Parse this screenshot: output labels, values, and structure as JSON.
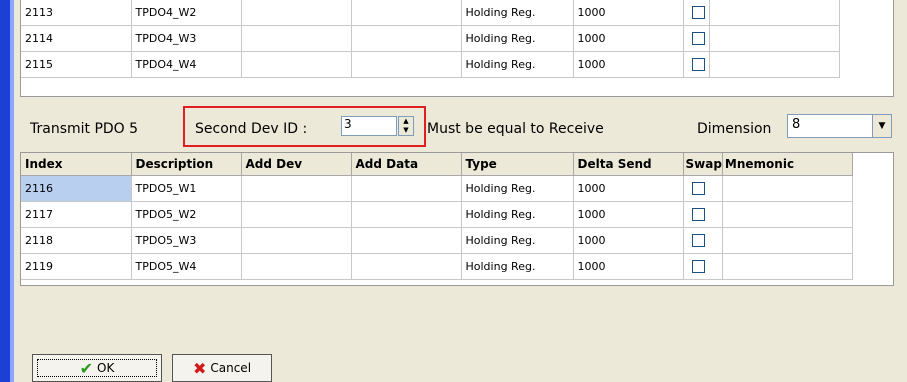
{
  "top_table": {
    "rows": [
      {
        "index": "2113",
        "description": "TPDO4_W2",
        "add_dev": "",
        "add_data": "",
        "type": "Holding Reg.",
        "delta_send": "1000",
        "mnemonic": ""
      },
      {
        "index": "2114",
        "description": "TPDO4_W3",
        "add_dev": "",
        "add_data": "",
        "type": "Holding Reg.",
        "delta_send": "1000",
        "mnemonic": ""
      },
      {
        "index": "2115",
        "description": "TPDO4_W4",
        "add_dev": "",
        "add_data": "",
        "type": "Holding Reg.",
        "delta_send": "1000",
        "mnemonic": ""
      }
    ]
  },
  "pdo5": {
    "label": "Transmit PDO 5",
    "second_dev_label": "Second Dev ID :",
    "second_dev_value": "3",
    "must_equal_label": "Must be equal to Receive",
    "dimension_label": "Dimension",
    "dimension_value": "8"
  },
  "bottom_table": {
    "headers": {
      "index": "Index",
      "description": "Description",
      "add_dev": "Add Dev",
      "add_data": "Add Data",
      "type": "Type",
      "delta_send": "Delta Send",
      "swap": "Swap",
      "mnemonic": "Mnemonic"
    },
    "rows": [
      {
        "index": "2116",
        "description": "TPDO5_W1",
        "add_dev": "",
        "add_data": "",
        "type": "Holding Reg.",
        "delta_send": "1000",
        "mnemonic": ""
      },
      {
        "index": "2117",
        "description": "TPDO5_W2",
        "add_dev": "",
        "add_data": "",
        "type": "Holding Reg.",
        "delta_send": "1000",
        "mnemonic": ""
      },
      {
        "index": "2118",
        "description": "TPDO5_W3",
        "add_dev": "",
        "add_data": "",
        "type": "Holding Reg.",
        "delta_send": "1000",
        "mnemonic": ""
      },
      {
        "index": "2119",
        "description": "TPDO5_W4",
        "add_dev": "",
        "add_data": "",
        "type": "Holding Reg.",
        "delta_send": "1000",
        "mnemonic": ""
      }
    ]
  },
  "buttons": {
    "ok": "OK",
    "cancel": "Cancel"
  },
  "icons": {
    "ok": "checkmark-icon",
    "cancel": "x-icon"
  },
  "colors": {
    "highlight_box": "#e02020",
    "selected_cell": "#b8cff0",
    "window_bg": "#ece9d8",
    "accent_bar": "#1c3fd6"
  }
}
